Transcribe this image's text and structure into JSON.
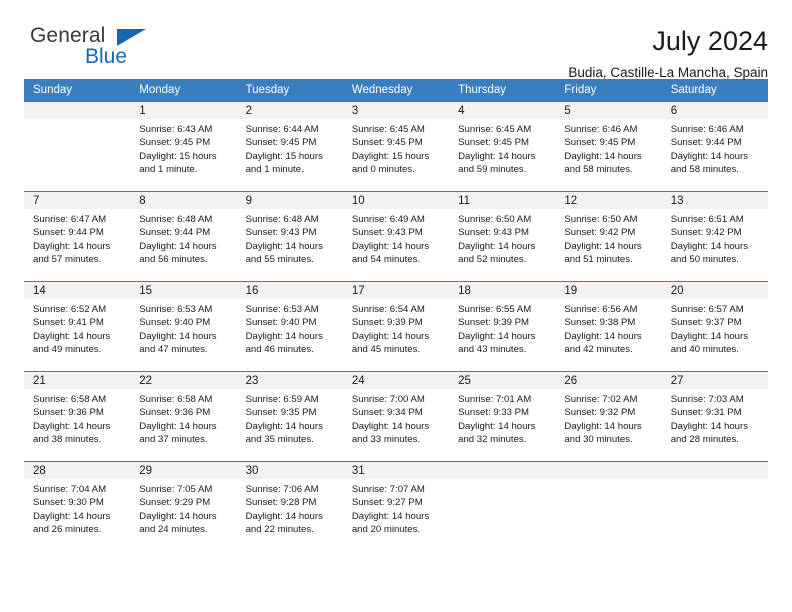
{
  "logo": {
    "word_one": "General",
    "word_two": "Blue",
    "triangle_icon": "blue-triangle-icon",
    "brand_color": "#1567b6"
  },
  "header": {
    "title": "July 2024",
    "subtitle": "Budia, Castille-La Mancha, Spain"
  },
  "theme": {
    "header_bg": "#3a7ebf",
    "header_text": "#ffffff",
    "daynum_band_bg": "#f2f2f2",
    "cell_bg": "#ffffff",
    "row_border": "#3a7ebf"
  },
  "calendar": {
    "weekday_headers": [
      "Sunday",
      "Monday",
      "Tuesday",
      "Wednesday",
      "Thursday",
      "Friday",
      "Saturday"
    ],
    "weeks": [
      [
        {
          "day": "",
          "empty": true,
          "sunrise": "",
          "sunset": "",
          "daylight_line1": "",
          "daylight_line2": ""
        },
        {
          "day": "1",
          "sunrise": "Sunrise: 6:43 AM",
          "sunset": "Sunset: 9:45 PM",
          "daylight_line1": "Daylight: 15 hours",
          "daylight_line2": "and 1 minute."
        },
        {
          "day": "2",
          "sunrise": "Sunrise: 6:44 AM",
          "sunset": "Sunset: 9:45 PM",
          "daylight_line1": "Daylight: 15 hours",
          "daylight_line2": "and 1 minute."
        },
        {
          "day": "3",
          "sunrise": "Sunrise: 6:45 AM",
          "sunset": "Sunset: 9:45 PM",
          "daylight_line1": "Daylight: 15 hours",
          "daylight_line2": "and 0 minutes."
        },
        {
          "day": "4",
          "sunrise": "Sunrise: 6:45 AM",
          "sunset": "Sunset: 9:45 PM",
          "daylight_line1": "Daylight: 14 hours",
          "daylight_line2": "and 59 minutes."
        },
        {
          "day": "5",
          "sunrise": "Sunrise: 6:46 AM",
          "sunset": "Sunset: 9:45 PM",
          "daylight_line1": "Daylight: 14 hours",
          "daylight_line2": "and 58 minutes."
        },
        {
          "day": "6",
          "sunrise": "Sunrise: 6:46 AM",
          "sunset": "Sunset: 9:44 PM",
          "daylight_line1": "Daylight: 14 hours",
          "daylight_line2": "and 58 minutes."
        }
      ],
      [
        {
          "day": "7",
          "sunrise": "Sunrise: 6:47 AM",
          "sunset": "Sunset: 9:44 PM",
          "daylight_line1": "Daylight: 14 hours",
          "daylight_line2": "and 57 minutes."
        },
        {
          "day": "8",
          "sunrise": "Sunrise: 6:48 AM",
          "sunset": "Sunset: 9:44 PM",
          "daylight_line1": "Daylight: 14 hours",
          "daylight_line2": "and 56 minutes."
        },
        {
          "day": "9",
          "sunrise": "Sunrise: 6:48 AM",
          "sunset": "Sunset: 9:43 PM",
          "daylight_line1": "Daylight: 14 hours",
          "daylight_line2": "and 55 minutes."
        },
        {
          "day": "10",
          "sunrise": "Sunrise: 6:49 AM",
          "sunset": "Sunset: 9:43 PM",
          "daylight_line1": "Daylight: 14 hours",
          "daylight_line2": "and 54 minutes."
        },
        {
          "day": "11",
          "sunrise": "Sunrise: 6:50 AM",
          "sunset": "Sunset: 9:43 PM",
          "daylight_line1": "Daylight: 14 hours",
          "daylight_line2": "and 52 minutes."
        },
        {
          "day": "12",
          "sunrise": "Sunrise: 6:50 AM",
          "sunset": "Sunset: 9:42 PM",
          "daylight_line1": "Daylight: 14 hours",
          "daylight_line2": "and 51 minutes."
        },
        {
          "day": "13",
          "sunrise": "Sunrise: 6:51 AM",
          "sunset": "Sunset: 9:42 PM",
          "daylight_line1": "Daylight: 14 hours",
          "daylight_line2": "and 50 minutes."
        }
      ],
      [
        {
          "day": "14",
          "sunrise": "Sunrise: 6:52 AM",
          "sunset": "Sunset: 9:41 PM",
          "daylight_line1": "Daylight: 14 hours",
          "daylight_line2": "and 49 minutes."
        },
        {
          "day": "15",
          "sunrise": "Sunrise: 6:53 AM",
          "sunset": "Sunset: 9:40 PM",
          "daylight_line1": "Daylight: 14 hours",
          "daylight_line2": "and 47 minutes."
        },
        {
          "day": "16",
          "sunrise": "Sunrise: 6:53 AM",
          "sunset": "Sunset: 9:40 PM",
          "daylight_line1": "Daylight: 14 hours",
          "daylight_line2": "and 46 minutes."
        },
        {
          "day": "17",
          "sunrise": "Sunrise: 6:54 AM",
          "sunset": "Sunset: 9:39 PM",
          "daylight_line1": "Daylight: 14 hours",
          "daylight_line2": "and 45 minutes."
        },
        {
          "day": "18",
          "sunrise": "Sunrise: 6:55 AM",
          "sunset": "Sunset: 9:39 PM",
          "daylight_line1": "Daylight: 14 hours",
          "daylight_line2": "and 43 minutes."
        },
        {
          "day": "19",
          "sunrise": "Sunrise: 6:56 AM",
          "sunset": "Sunset: 9:38 PM",
          "daylight_line1": "Daylight: 14 hours",
          "daylight_line2": "and 42 minutes."
        },
        {
          "day": "20",
          "sunrise": "Sunrise: 6:57 AM",
          "sunset": "Sunset: 9:37 PM",
          "daylight_line1": "Daylight: 14 hours",
          "daylight_line2": "and 40 minutes."
        }
      ],
      [
        {
          "day": "21",
          "sunrise": "Sunrise: 6:58 AM",
          "sunset": "Sunset: 9:36 PM",
          "daylight_line1": "Daylight: 14 hours",
          "daylight_line2": "and 38 minutes."
        },
        {
          "day": "22",
          "sunrise": "Sunrise: 6:58 AM",
          "sunset": "Sunset: 9:36 PM",
          "daylight_line1": "Daylight: 14 hours",
          "daylight_line2": "and 37 minutes."
        },
        {
          "day": "23",
          "sunrise": "Sunrise: 6:59 AM",
          "sunset": "Sunset: 9:35 PM",
          "daylight_line1": "Daylight: 14 hours",
          "daylight_line2": "and 35 minutes."
        },
        {
          "day": "24",
          "sunrise": "Sunrise: 7:00 AM",
          "sunset": "Sunset: 9:34 PM",
          "daylight_line1": "Daylight: 14 hours",
          "daylight_line2": "and 33 minutes."
        },
        {
          "day": "25",
          "sunrise": "Sunrise: 7:01 AM",
          "sunset": "Sunset: 9:33 PM",
          "daylight_line1": "Daylight: 14 hours",
          "daylight_line2": "and 32 minutes."
        },
        {
          "day": "26",
          "sunrise": "Sunrise: 7:02 AM",
          "sunset": "Sunset: 9:32 PM",
          "daylight_line1": "Daylight: 14 hours",
          "daylight_line2": "and 30 minutes."
        },
        {
          "day": "27",
          "sunrise": "Sunrise: 7:03 AM",
          "sunset": "Sunset: 9:31 PM",
          "daylight_line1": "Daylight: 14 hours",
          "daylight_line2": "and 28 minutes."
        }
      ],
      [
        {
          "day": "28",
          "sunrise": "Sunrise: 7:04 AM",
          "sunset": "Sunset: 9:30 PM",
          "daylight_line1": "Daylight: 14 hours",
          "daylight_line2": "and 26 minutes."
        },
        {
          "day": "29",
          "sunrise": "Sunrise: 7:05 AM",
          "sunset": "Sunset: 9:29 PM",
          "daylight_line1": "Daylight: 14 hours",
          "daylight_line2": "and 24 minutes."
        },
        {
          "day": "30",
          "sunrise": "Sunrise: 7:06 AM",
          "sunset": "Sunset: 9:28 PM",
          "daylight_line1": "Daylight: 14 hours",
          "daylight_line2": "and 22 minutes."
        },
        {
          "day": "31",
          "sunrise": "Sunrise: 7:07 AM",
          "sunset": "Sunset: 9:27 PM",
          "daylight_line1": "Daylight: 14 hours",
          "daylight_line2": "and 20 minutes."
        },
        {
          "day": "",
          "empty": true,
          "sunrise": "",
          "sunset": "",
          "daylight_line1": "",
          "daylight_line2": ""
        },
        {
          "day": "",
          "empty": true,
          "sunrise": "",
          "sunset": "",
          "daylight_line1": "",
          "daylight_line2": ""
        },
        {
          "day": "",
          "empty": true,
          "sunrise": "",
          "sunset": "",
          "daylight_line1": "",
          "daylight_line2": ""
        }
      ]
    ]
  }
}
